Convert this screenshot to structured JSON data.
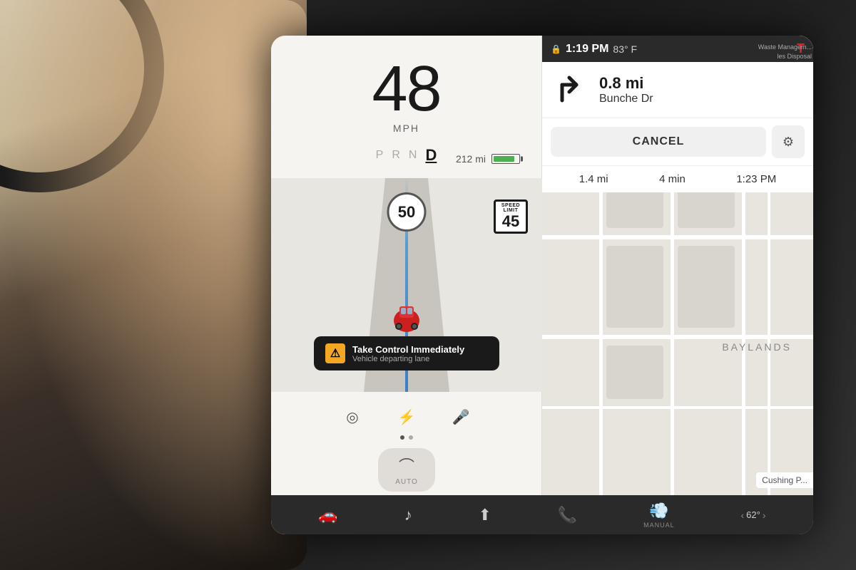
{
  "scene": {
    "bg_color": "#1a1a1a"
  },
  "screen": {
    "speed": "48",
    "speed_unit": "MPH",
    "gear": {
      "options": [
        "P",
        "R",
        "N",
        "D"
      ],
      "active": "D"
    },
    "range": "212 mi",
    "speed_limit": "50",
    "speed_limit_box_label": "SPEED LIMIT",
    "speed_limit_box": "45",
    "alert": {
      "title": "Take Control Immediately",
      "subtitle": "Vehicle departing lane"
    },
    "wiper_label": "AUTO",
    "dots": [
      1,
      2
    ],
    "active_dot": 0
  },
  "navigation": {
    "time": "1:19 PM",
    "temp": "83° F",
    "tesla_logo": "T",
    "side_text": "Waste Management\nles Disposal",
    "turn_distance": "0.8 mi",
    "turn_street": "Bunche Dr",
    "cancel_label": "CANCEL",
    "settings_icon": "⚙",
    "trip_distance": "1.4 mi",
    "trip_time": "4 min",
    "trip_eta": "1:23 PM",
    "map_label": "BAYLANDS",
    "cushing_label": "Cushing P..."
  },
  "taskbar": {
    "icons": [
      "🚗",
      "♪",
      "⬆",
      "📞",
      "💨"
    ],
    "temp_value": "62°",
    "temp_label": "MANUAL"
  }
}
